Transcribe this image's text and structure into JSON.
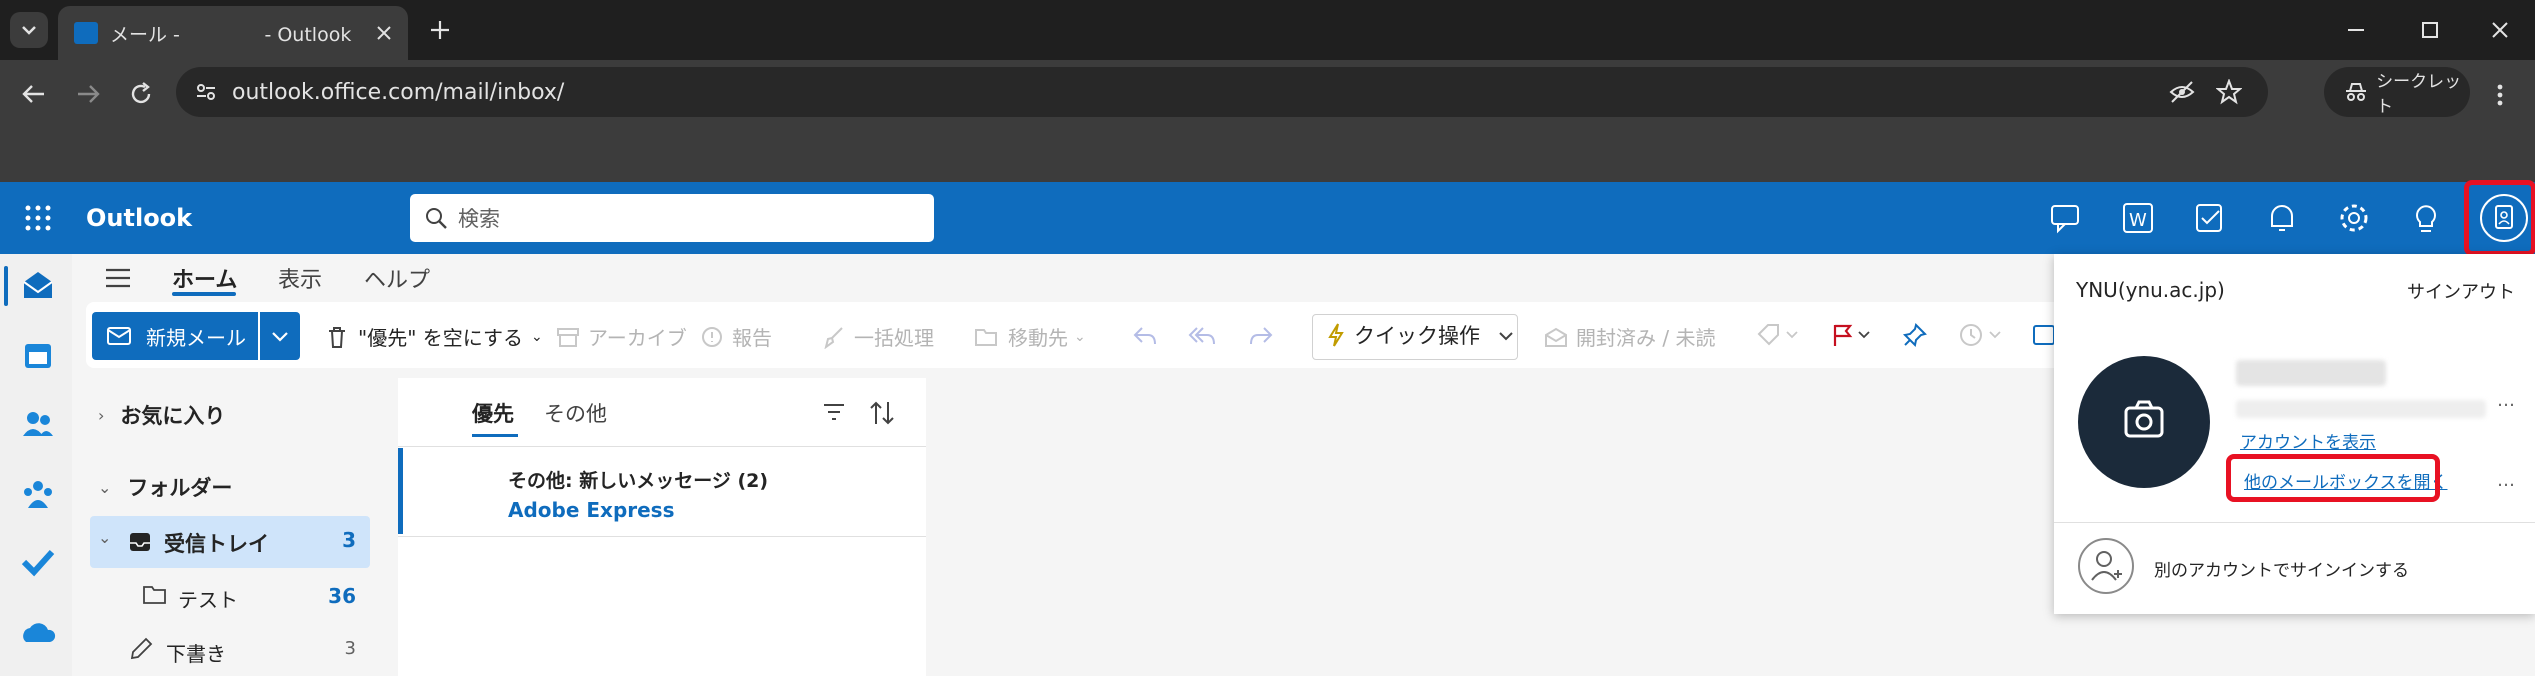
{
  "browser": {
    "tab_title": "メール -              - Outlook",
    "url": "outlook.office.com/mail/inbox/",
    "incognito_label": "シークレット"
  },
  "outlook": {
    "app_name": "Outlook",
    "search_placeholder": "検索"
  },
  "ribbon": {
    "tabs": [
      "ホーム",
      "表示",
      "ヘルプ"
    ],
    "new_mail": "新規メール",
    "empty_focused": "\"優先\" を空にする",
    "archive": "アーカイブ",
    "report": "報告",
    "sweep": "一括処理",
    "move_to": "移動先",
    "quick_steps": "クイック操作",
    "read_unread": "開封済み / 未読"
  },
  "folders": {
    "favorites": "お気に入り",
    "folders": "フォルダー",
    "inbox": "受信トレイ",
    "inbox_count": "3",
    "test": "テスト",
    "test_count": "36",
    "drafts": "下書き",
    "drafts_count": "3"
  },
  "message_list": {
    "tab_focused": "優先",
    "tab_other": "その他",
    "item_title": "その他: 新しいメッセージ (2)",
    "item_sender": "Adobe Express"
  },
  "account_popup": {
    "org": "YNU(ynu.ac.jp)",
    "sign_out": "サインアウト",
    "view_account": "アカウントを表示",
    "open_other_mailbox": "他のメールボックスを開く",
    "more": "…",
    "more2": "…",
    "sign_in_other": "別のアカウントでサインインする"
  },
  "colors": {
    "outlook_blue": "#0f6cbd",
    "highlight_red": "#e81123",
    "selected_folder": "#cfe4fa"
  }
}
